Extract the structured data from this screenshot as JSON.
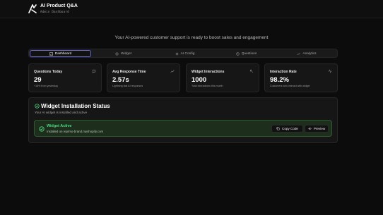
{
  "header": {
    "title": "AI Product Q&A",
    "subtitle": "Admin Dashboard"
  },
  "tagline": "Your AI-powered customer support is ready to boost sales and engagement",
  "tabs": [
    {
      "label": "Dashboard",
      "icon": "dashboard-icon",
      "active": true
    },
    {
      "label": "Widget",
      "icon": "widget-icon",
      "active": false
    },
    {
      "label": "AI Config",
      "icon": "gear-icon",
      "active": false
    },
    {
      "label": "Questions",
      "icon": "question-icon",
      "active": false
    },
    {
      "label": "Analytics",
      "icon": "trend-icon",
      "active": false
    }
  ],
  "stats": [
    {
      "title": "Questions Today",
      "value": "29",
      "note": "+16% from yesterday",
      "icon": "chat-icon"
    },
    {
      "title": "Avg Response Time",
      "value": "2.57s",
      "note": "Lightning fast AI responses",
      "icon": "trend-icon"
    },
    {
      "title": "Widget Interactions",
      "value": "1000",
      "note": "Total interactions this month",
      "icon": "pointer-icon"
    },
    {
      "title": "Interaction Rate",
      "value": "98.2%",
      "note": "Customers who interact with widget",
      "icon": "activity-icon"
    }
  ],
  "install": {
    "title": "Widget Installation Status",
    "subtitle": "Your AI widget is installed and active",
    "status_title": "Widget Active",
    "status_detail": "Installed on rep/mo-brand.myshopify.com",
    "copy_label": "Copy Code",
    "preview_label": "Preview"
  },
  "colors": {
    "accent": "#6a6ad8",
    "success": "#4ade80",
    "success_bg": "#1d2e1d",
    "background": "#0c0c0c"
  }
}
